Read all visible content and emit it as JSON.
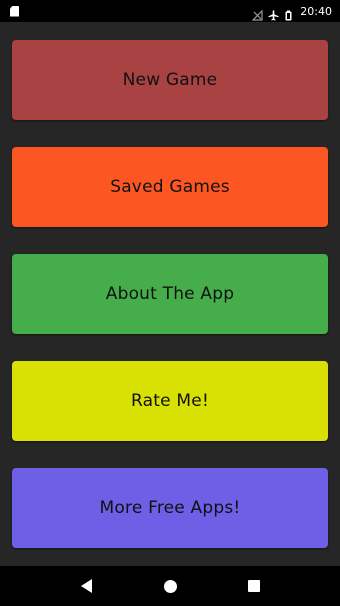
{
  "status_bar": {
    "time": "20:40",
    "icons": [
      "sd-card-icon",
      "no-signal-icon",
      "airplane-mode-icon",
      "battery-icon"
    ]
  },
  "menu": {
    "items": [
      {
        "label": "New Game",
        "color": "#a94242"
      },
      {
        "label": "Saved Games",
        "color": "#fc5622"
      },
      {
        "label": "About The App",
        "color": "#45ae4a"
      },
      {
        "label": "Rate Me!",
        "color": "#d9e004"
      },
      {
        "label": "More Free Apps!",
        "color": "#6e5fe6"
      }
    ]
  },
  "nav_bar": {
    "icons": [
      "back-icon",
      "home-icon",
      "recents-icon"
    ]
  }
}
